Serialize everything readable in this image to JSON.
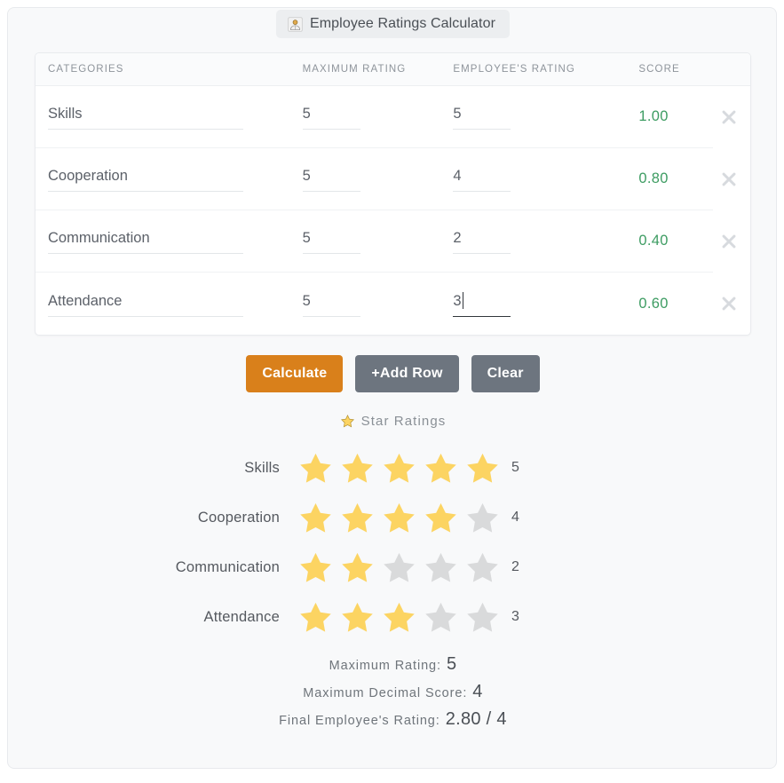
{
  "window": {
    "title": "Employee Ratings Calculator",
    "title_icon": "person-bust-icon"
  },
  "table": {
    "headers": {
      "categories": "CATEGORIES",
      "maximum_rating": "MAXIMUM RATING",
      "employees_rating": "EMPLOYEE'S RATING",
      "score": "SCORE"
    },
    "delete_icon": "close-x-icon",
    "rows": [
      {
        "category": "Skills",
        "maximum_rating": "5",
        "employees_rating": "5",
        "score": "1.00",
        "focused": false
      },
      {
        "category": "Cooperation",
        "maximum_rating": "5",
        "employees_rating": "4",
        "score": "0.80",
        "focused": false
      },
      {
        "category": "Communication",
        "maximum_rating": "5",
        "employees_rating": "2",
        "score": "0.40",
        "focused": false
      },
      {
        "category": "Attendance",
        "maximum_rating": "5",
        "employees_rating": "3",
        "score": "0.60",
        "focused": true
      }
    ]
  },
  "buttons": {
    "calculate": "Calculate",
    "add_row": "+Add Row",
    "clear": "Clear"
  },
  "star_section": {
    "heading": "Star Ratings",
    "heading_icon": "star-icon",
    "max_stars": 5,
    "rows": [
      {
        "label": "Skills",
        "filled": 5,
        "value": "5"
      },
      {
        "label": "Cooperation",
        "filled": 4,
        "value": "4"
      },
      {
        "label": "Communication",
        "filled": 2,
        "value": "2"
      },
      {
        "label": "Attendance",
        "filled": 3,
        "value": "3"
      }
    ]
  },
  "summary": [
    {
      "label": "Maximum Rating:",
      "value": "5"
    },
    {
      "label": "Maximum Decimal Score:",
      "value": "4"
    },
    {
      "label": "Final Employee's Rating:",
      "value": "2.80 / 4"
    }
  ],
  "colors": {
    "accent_orange": "#d9801b",
    "button_gray": "#6d757f",
    "score_green": "#3d9c62",
    "star_filled": "#fcd462",
    "star_empty": "#d9dadb"
  }
}
